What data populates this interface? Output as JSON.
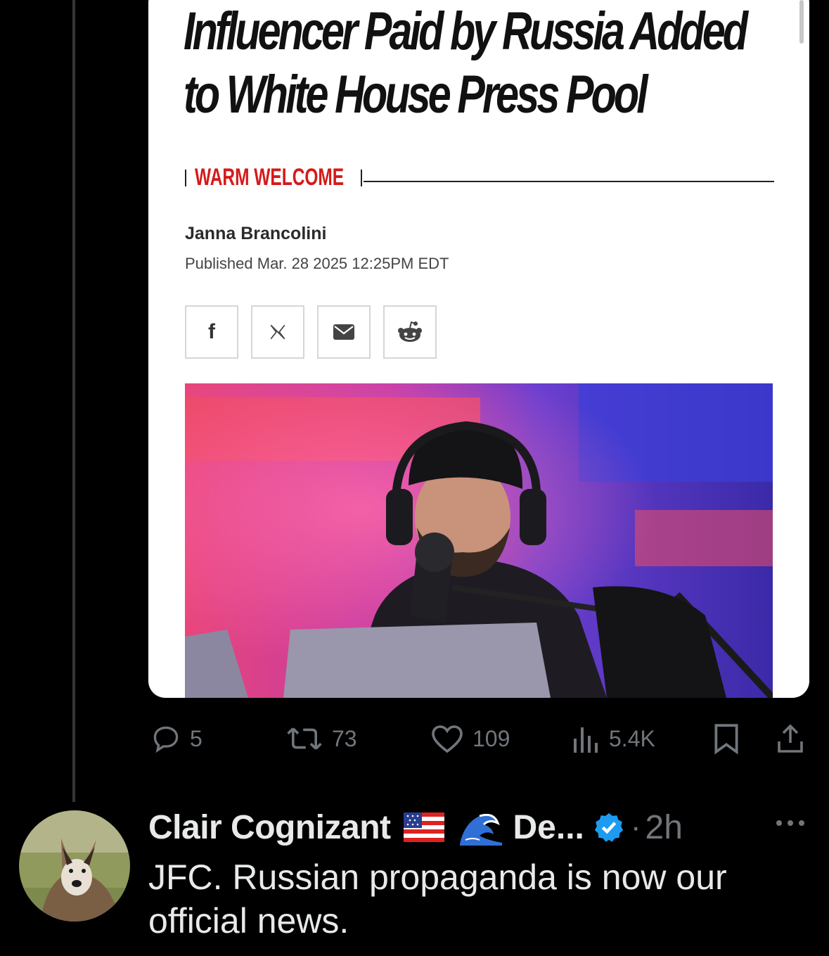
{
  "article": {
    "headline_line1": "Influencer Paid by Russia Added",
    "headline_line2": "to White House Press Pool",
    "kicker": "WARM WELCOME",
    "author": "Janna Brancolini",
    "published": "Published Mar. 28 2025 12:25PM EDT",
    "share_icons": [
      "facebook-icon",
      "x-icon",
      "mail-icon",
      "reddit-icon"
    ],
    "share_labels": {
      "facebook": "f"
    }
  },
  "actions": {
    "replies": "5",
    "reposts": "73",
    "likes": "109",
    "views": "5.4K"
  },
  "reply": {
    "display_name": "Clair Cognizant",
    "handle_truncated": "De...",
    "dot": "·",
    "time": "2h",
    "text": "JFC. Russian propaganda is now our official news."
  },
  "colors": {
    "background": "#000000",
    "text": "#e7e9ea",
    "muted": "#71767b",
    "verified": "#1d9bf0",
    "kicker": "#d51a1a"
  }
}
